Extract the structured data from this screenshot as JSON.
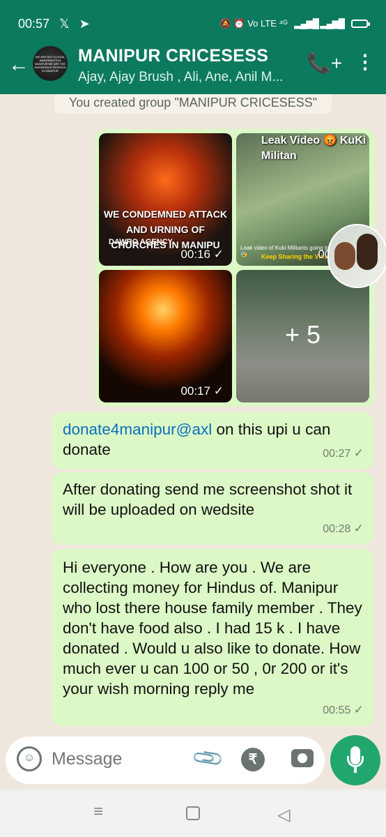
{
  "status": {
    "time": "00:57",
    "x_icon": "𝕏",
    "telegram_icon": "➤",
    "indicators": "🔕 ⏰ Vo LTE ⁴ᴳ",
    "signal": "▂▄▆█ ▂▄▆█"
  },
  "header": {
    "back_icon": "←",
    "title": "MANIPUR CRICESESS",
    "members": "Ajay, Ajay Brush , Ali, Ane, Anil M...",
    "avatar_text": "WE ARE NOT ILLEGAL IMMIGRANTS IN MANIPUR WE ARE THE INDIGENOUS PEOPLES IN MANIPUR",
    "call_icon": "📞+",
    "more_icon": "⋮"
  },
  "chat": {
    "system_message": "You created group \"MANIPUR CRICESESS\"",
    "media": [
      {
        "caption": "WE CONDEMNED ATTACK AND URNING OF CHURCHES IN MANIPU",
        "brand": "DAWRO AGENCY",
        "duration": "00:16",
        "tick": "✓"
      },
      {
        "title": "Leak Video 😡 KuKi Militan",
        "caption": "Leak video of Kuki Militants going towards Valley 😡😰",
        "share": "Keep Sharing the Video",
        "duration": "00:17",
        "tick": "✓"
      },
      {
        "duration": "00:17",
        "tick": "✓"
      },
      {
        "more": "+ 5"
      }
    ],
    "messages": [
      {
        "link": "donate4manipur@axl",
        "text": " on this upi u can donate",
        "time": "00:27",
        "tick": "✓"
      },
      {
        "text": "After donating send me screenshot shot it will be uploaded on wedsite",
        "time": "00:28",
        "tick": "✓"
      },
      {
        "text": "Hi everyone . How are you . We are collecting money for Hindus of. Manipur who lost there house family member . They don't have food also . I had 15 k . I have donated . Would u also like to donate.  How much ever u can 100 or 50 , 0r 200 or it's your wish morning reply me",
        "time": "00:55",
        "tick": "✓"
      }
    ]
  },
  "input": {
    "placeholder": "Message",
    "emoji_icon": "☺",
    "attach_icon": "📎",
    "rupee_icon": "₹"
  },
  "nav": {
    "menu_icon": "≡",
    "back_icon": "◁"
  }
}
